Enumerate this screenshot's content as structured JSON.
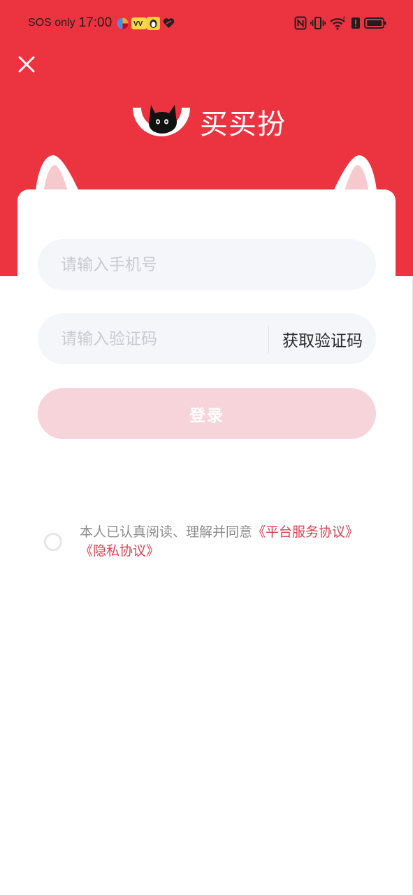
{
  "status_bar": {
    "carrier": "SOS only",
    "time": "17:00"
  },
  "brand": {
    "name": "买买扮"
  },
  "form": {
    "phone_placeholder": "请输入手机号",
    "code_placeholder": "请输入验证码",
    "get_code_label": "获取验证码",
    "login_label": "登录"
  },
  "agreement": {
    "prefix": "本人已认真阅读、理解并同意",
    "service_link": "《平台服务协议》",
    "privacy_link": "《隐私协议》"
  },
  "colors": {
    "primary_red": "#EC3340",
    "login_disabled": "#F7D4D9",
    "link": "#D6424F"
  },
  "icons": [
    "close-icon",
    "nfc-icon",
    "vibrate-icon",
    "wifi-icon",
    "alert-icon",
    "battery-icon"
  ]
}
